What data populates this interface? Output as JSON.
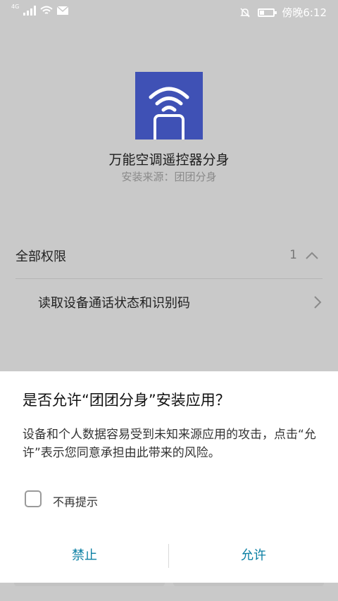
{
  "status_bar": {
    "network_type": "4G",
    "time": "傍晚6:12",
    "icons": [
      "signal-icon",
      "wifi-icon",
      "mail-icon",
      "alarm-off-icon",
      "battery-icon"
    ]
  },
  "app": {
    "name": "万能空调遥控器分身",
    "source": "安装来源：团团分身",
    "icon": "remote-wifi-icon",
    "icon_color": "#3f51b5"
  },
  "permissions": {
    "header_label": "全部权限",
    "count": "1",
    "items": [
      {
        "label": "读取设备通话状态和识别码"
      }
    ]
  },
  "dialog": {
    "title": "是否允许“团团分身”安装应用？",
    "body": "设备和个人数据容易受到未知来源应用的攻击，点击“允许”表示您同意承担由此带来的风险。",
    "checkbox_label": "不再提示",
    "checkbox_checked": false,
    "deny_label": "禁止",
    "allow_label": "允许",
    "accent_color": "#0a7fa3"
  }
}
